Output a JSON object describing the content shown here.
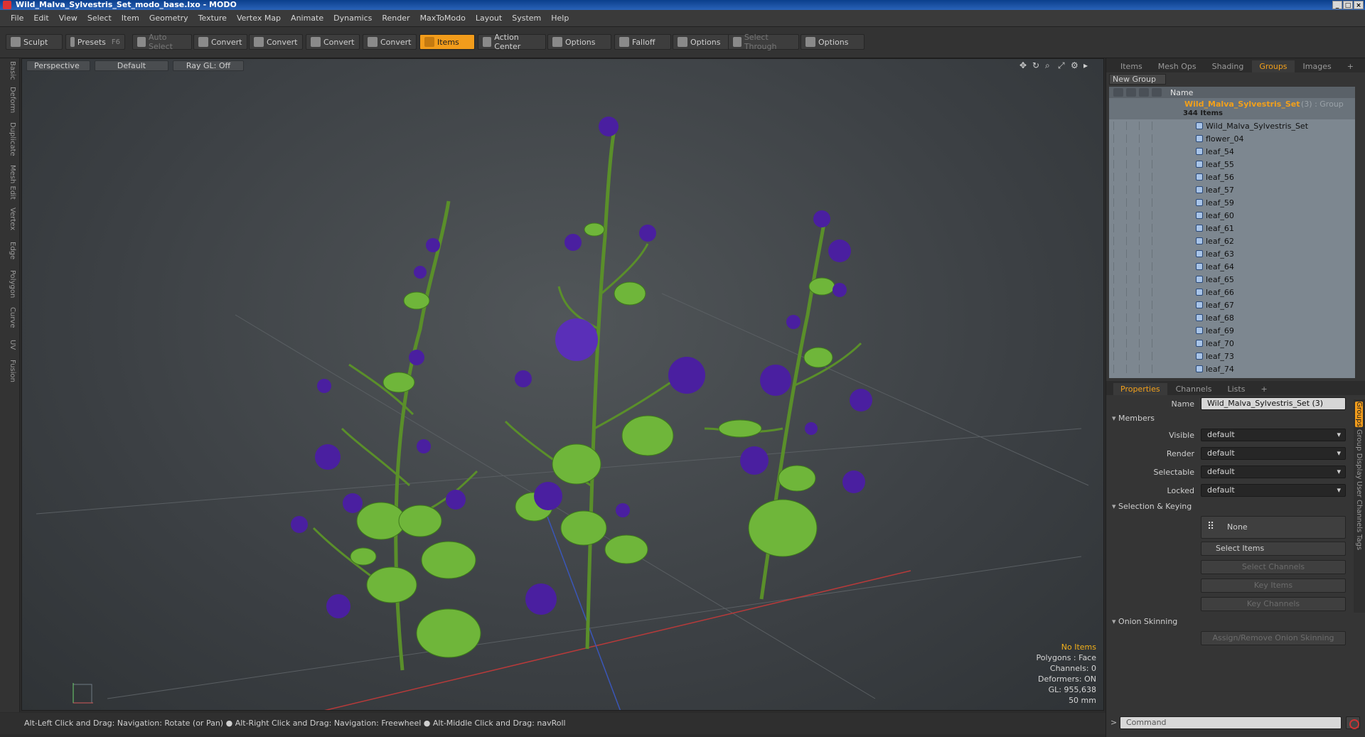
{
  "window": {
    "title": "Wild_Malva_Sylvestris_Set_modo_base.lxo - MODO"
  },
  "menu": [
    "File",
    "Edit",
    "View",
    "Select",
    "Item",
    "Geometry",
    "Texture",
    "Vertex Map",
    "Animate",
    "Dynamics",
    "Render",
    "MaxToModo",
    "Layout",
    "System",
    "Help"
  ],
  "toolbar": {
    "sculpt": "Sculpt",
    "presets": "Presets",
    "presets_key": "F6",
    "auto_select": "Auto Select",
    "convert": "Convert",
    "items": "Items",
    "action_center": "Action Center",
    "options": "Options",
    "falloff": "Falloff",
    "select_through": "Select Through"
  },
  "left_tabs": [
    "Basic",
    "Deform",
    "Duplicate",
    "Mesh Edit",
    "Vertex",
    "Edge",
    "Polygon",
    "Curve",
    "UV",
    "Fusion"
  ],
  "viewport": {
    "view": "Perspective",
    "shading": "Default",
    "raygl": "Ray GL: Off",
    "info": {
      "selection": "No Items",
      "polygons": "Polygons : Face",
      "channels": "Channels: 0",
      "deformers": "Deformers: ON",
      "gl": "GL: 955,638",
      "focal": "50 mm"
    }
  },
  "groups_panel": {
    "tabs": [
      "Items",
      "Mesh Ops",
      "Shading",
      "Groups",
      "Images"
    ],
    "active_tab": "Groups",
    "new_group": "New Group",
    "name_header": "Name",
    "group_name": "Wild_Malva_Sylvestris_Set",
    "group_suffix": "(3) : Group",
    "group_count": "344 Items",
    "items": [
      "Wild_Malva_Sylvestris_Set",
      "flower_04",
      "leaf_54",
      "leaf_55",
      "leaf_56",
      "leaf_57",
      "leaf_59",
      "leaf_60",
      "leaf_61",
      "leaf_62",
      "leaf_63",
      "leaf_64",
      "leaf_65",
      "leaf_66",
      "leaf_67",
      "leaf_68",
      "leaf_69",
      "leaf_70",
      "leaf_73",
      "leaf_74"
    ]
  },
  "properties": {
    "tabs": [
      "Properties",
      "Channels",
      "Lists"
    ],
    "name_label": "Name",
    "name_value": "Wild_Malva_Sylvestris_Set (3)",
    "members_section": "Members",
    "visible_label": "Visible",
    "render_label": "Render",
    "selectable_label": "Selectable",
    "locked_label": "Locked",
    "default_value": "default",
    "selection_section": "Selection & Keying",
    "none_btn": "None",
    "select_items": "Select Items",
    "select_channels": "Select Channels",
    "key_items": "Key Items",
    "key_channels": "Key Channels",
    "onion_section": "Onion Skinning",
    "onion_btn": "Assign/Remove Onion Skinning",
    "side_tabs": [
      "Groups",
      "Group Display",
      "User Channels",
      "Tags"
    ]
  },
  "status": {
    "hint": "Alt-Left Click and Drag: Navigation: Rotate (or Pan) ● Alt-Right Click and Drag: Navigation: Freewheel ● Alt-Middle Click and Drag: navRoll",
    "command_placeholder": "Command"
  },
  "colors": {
    "accent": "#f29c1b",
    "leaf": "#6fb63a",
    "flower": "#4a1fa0"
  }
}
